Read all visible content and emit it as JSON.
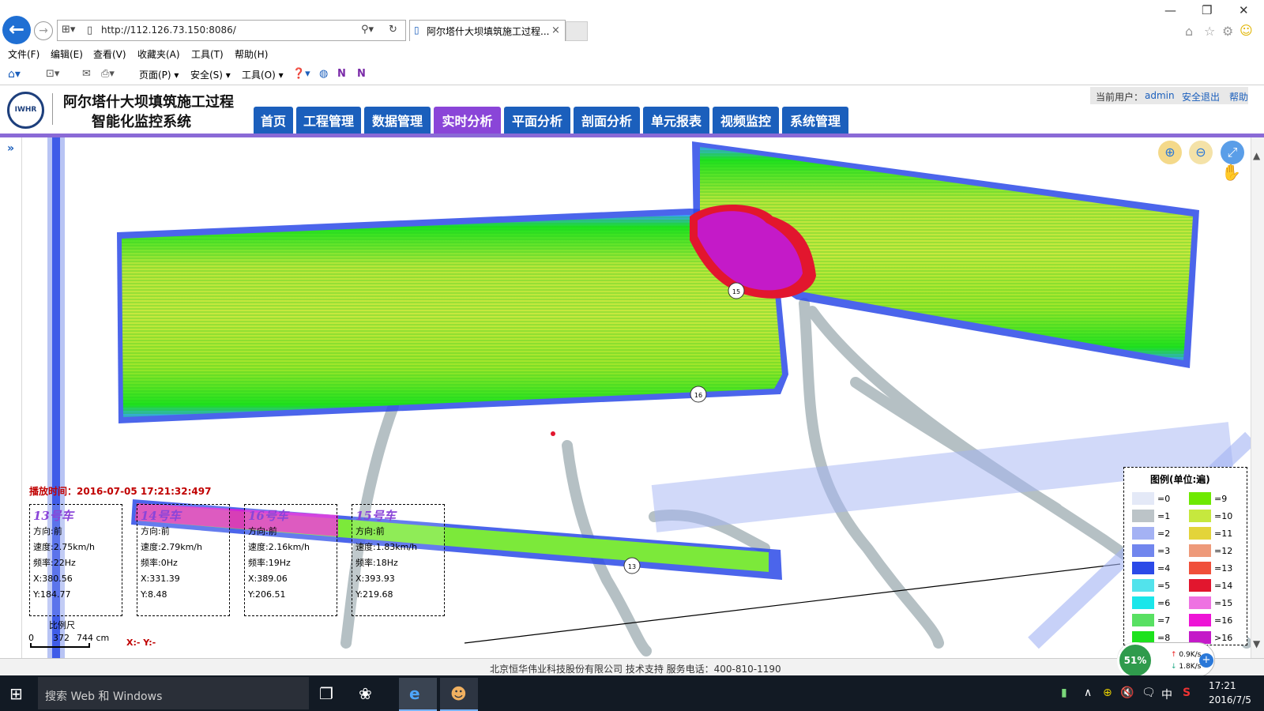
{
  "browser": {
    "url": "http://112.126.73.150:8086/",
    "tab_title": "阿尔塔什大坝填筑施工过程...",
    "tab_close": "×",
    "menu": [
      "文件(F)",
      "编辑(E)",
      "查看(V)",
      "收藏夹(A)",
      "工具(T)",
      "帮助(H)"
    ],
    "commands": {
      "page": "页面(P)",
      "safety": "安全(S)",
      "tools": "工具(O)"
    }
  },
  "app": {
    "logo_text": "IWHR",
    "title_line1": "阿尔塔什大坝填筑施工过程",
    "title_line2": "智能化监控系统",
    "nav": [
      "首页",
      "工程管理",
      "数据管理",
      "实时分析",
      "平面分析",
      "剖面分析",
      "单元报表",
      "视频监控",
      "系统管理"
    ],
    "active_nav": "实时分析",
    "user_label": "当前用户：",
    "username": "admin",
    "logout": "安全退出",
    "help": "帮助",
    "accent": "#1b5fbc",
    "active_color": "#8a45d8"
  },
  "map": {
    "playback_time": "播放时间：2016-07-05 17:21:32:497",
    "markers": [
      "15",
      "16",
      "13"
    ],
    "vehicles": [
      {
        "title_num": "13",
        "title_suffix": "号车",
        "direction": "方向:前",
        "speed": "速度:2.75km/h",
        "freq": "频率:22Hz",
        "x": "X:380.56",
        "y": "Y:184.77"
      },
      {
        "title_num": "14",
        "title_suffix": "号车",
        "direction": "方向:前",
        "speed": "速度:2.79km/h",
        "freq": "频率:0Hz",
        "x": "X:331.39",
        "y": "Y:8.48"
      },
      {
        "title_num": "16",
        "title_suffix": "号车",
        "direction": "方向:前",
        "speed": "速度:2.16km/h",
        "freq": "频率:19Hz",
        "x": "X:389.06",
        "y": "Y:206.51"
      },
      {
        "title_num": "15",
        "title_suffix": "号车",
        "direction": "方向:前",
        "speed": "速度:1.83km/h",
        "freq": "频率:18Hz",
        "x": "X:393.93",
        "y": "Y:219.68"
      }
    ],
    "scale": {
      "label": "比例尺",
      "t0": "0",
      "t1": "372",
      "t2": "744 cm"
    },
    "coords": "X:-   Y:-",
    "legend_title": "图例(单位:遍)",
    "legend": [
      {
        "label": "=0",
        "color": "#e4e9f7"
      },
      {
        "label": "=1",
        "color": "#bcc4c8"
      },
      {
        "label": "=2",
        "color": "#a4b2f4"
      },
      {
        "label": "=3",
        "color": "#7186ee"
      },
      {
        "label": "=4",
        "color": "#2b4ae8"
      },
      {
        "label": "=5",
        "color": "#52e3ec"
      },
      {
        "label": "=6",
        "color": "#1ae6ea"
      },
      {
        "label": "=7",
        "color": "#58e062"
      },
      {
        "label": "=8",
        "color": "#1de21d"
      },
      {
        "label": "=9",
        "color": "#6ee900"
      },
      {
        "label": "=10",
        "color": "#c6e83e"
      },
      {
        "label": "=11",
        "color": "#e3d43a"
      },
      {
        "label": "=12",
        "color": "#ee9a7a"
      },
      {
        "label": "=13",
        "color": "#f0503a"
      },
      {
        "label": "=14",
        "color": "#e2162e"
      },
      {
        "label": "=15",
        "color": "#ee72e2"
      },
      {
        "label": "=16",
        "color": "#ee14d6"
      },
      {
        "label": ">16",
        "color": "#c41ac8"
      }
    ]
  },
  "footer": {
    "text": "北京恒华伟业科技股份有限公司 技术支持  服务电话：400-810-1190"
  },
  "net": {
    "percent": "51%",
    "up": "0.9K/s",
    "down": "1.8K/s"
  },
  "taskbar": {
    "search": "搜索 Web 和 Windows",
    "time": "17:21",
    "date": "2016/7/5",
    "ime": "中"
  }
}
